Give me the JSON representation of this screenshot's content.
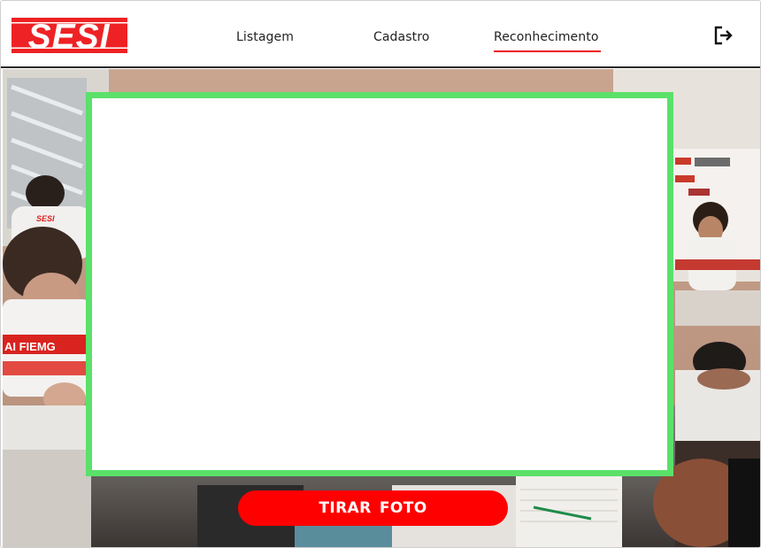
{
  "brand": {
    "logo_text": "SESI",
    "color": "#ee2224"
  },
  "nav": {
    "items": [
      {
        "label": "Listagem"
      },
      {
        "label": "Cadastro"
      },
      {
        "label": "Reconhecimento",
        "active": true
      }
    ]
  },
  "header": {
    "logout_icon": "logout-icon"
  },
  "camera": {
    "frame_color": "#5be06a",
    "shirt_text_left": "AI FIEMG"
  },
  "actions": {
    "shoot_label": "TIRAR  FOTO",
    "shoot_color": "#ff0000"
  }
}
